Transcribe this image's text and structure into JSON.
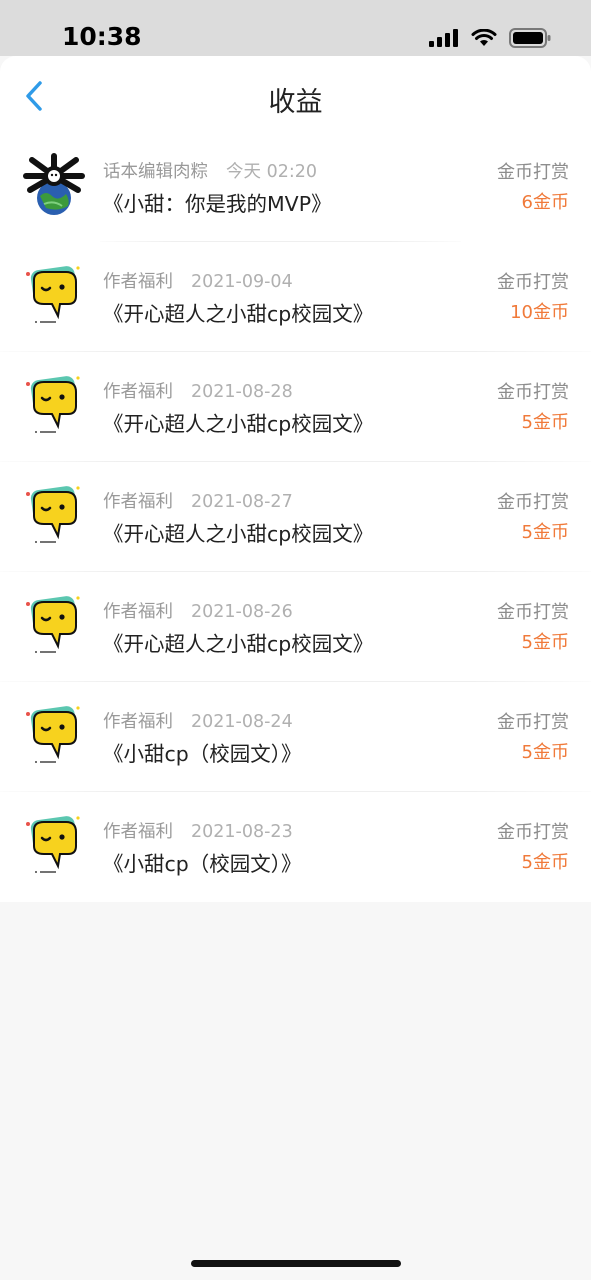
{
  "status_bar": {
    "time": "10:38"
  },
  "nav": {
    "title": "收益"
  },
  "colors": {
    "accent_blue": "#2f9be8",
    "amount_orange": "#f07a3a"
  },
  "records": [
    {
      "source": "话本编辑肉粽",
      "date": "今天 02:20",
      "book": "《小甜：你是我的MVP》",
      "type": "金币打赏",
      "amount": "6金币",
      "avatar": "editor-avatar"
    },
    {
      "source": "作者福利",
      "date": "2021-09-04",
      "book": "《开心超人之小甜cp校园文》",
      "type": "金币打赏",
      "amount": "10金币",
      "avatar": "chat-bubble-avatar"
    },
    {
      "source": "作者福利",
      "date": "2021-08-28",
      "book": "《开心超人之小甜cp校园文》",
      "type": "金币打赏",
      "amount": "5金币",
      "avatar": "chat-bubble-avatar"
    },
    {
      "source": "作者福利",
      "date": "2021-08-27",
      "book": "《开心超人之小甜cp校园文》",
      "type": "金币打赏",
      "amount": "5金币",
      "avatar": "chat-bubble-avatar"
    },
    {
      "source": "作者福利",
      "date": "2021-08-26",
      "book": "《开心超人之小甜cp校园文》",
      "type": "金币打赏",
      "amount": "5金币",
      "avatar": "chat-bubble-avatar"
    },
    {
      "source": "作者福利",
      "date": "2021-08-24",
      "book": "《小甜cp（校园文）》",
      "type": "金币打赏",
      "amount": "5金币",
      "avatar": "chat-bubble-avatar"
    },
    {
      "source": "作者福利",
      "date": "2021-08-23",
      "book": "《小甜cp（校园文）》",
      "type": "金币打赏",
      "amount": "5金币",
      "avatar": "chat-bubble-avatar"
    }
  ]
}
